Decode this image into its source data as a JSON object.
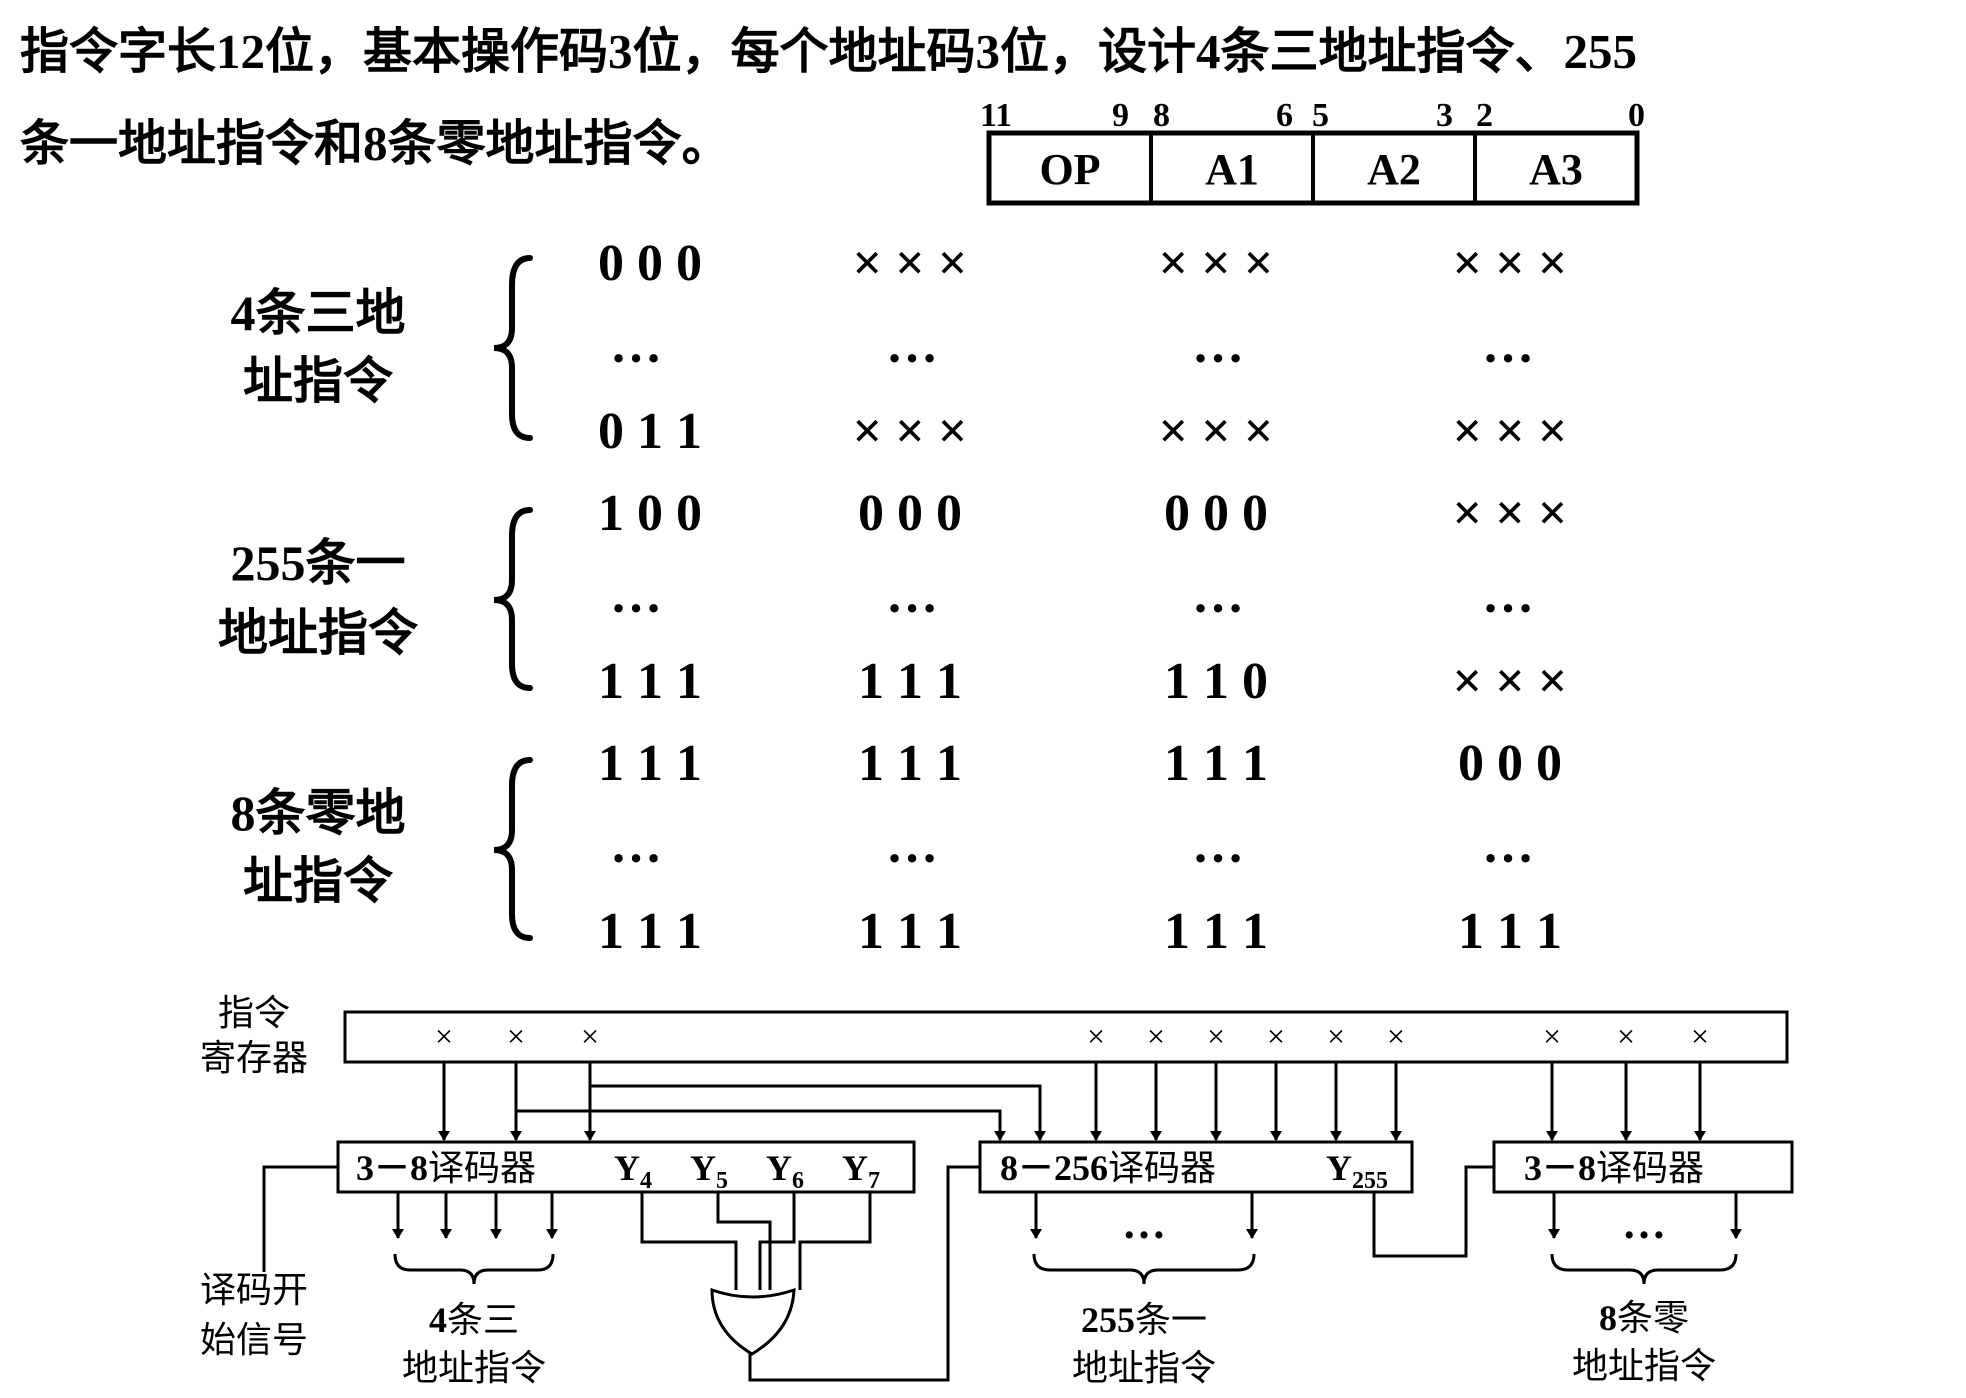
{
  "heading": {
    "line1": "指令字长12位，基本操作码3位，每个地址码3位，设计4条三地址指令、255",
    "line2": "条一地址指令和8条零地址指令。"
  },
  "format": {
    "bit_labels": [
      "11",
      "9",
      "8",
      "6",
      "5",
      "3",
      "2",
      "0"
    ],
    "fields": [
      "OP",
      "A1",
      "A2",
      "A3"
    ]
  },
  "groups": [
    {
      "label_line1": "4条三地",
      "label_line2": "址指令",
      "first": [
        "0 0 0",
        "× × ×",
        "× × ×",
        "× × ×"
      ],
      "last": [
        "0 1 1",
        "× × ×",
        "× × ×",
        "× × ×"
      ]
    },
    {
      "label_line1": "255条一",
      "label_line2": "地址指令",
      "first": [
        "1 0 0",
        "0 0 0",
        "0 0 0",
        "× × ×"
      ],
      "last": [
        "1 1 1",
        "1 1 1",
        "1 1 0",
        "× × ×"
      ]
    },
    {
      "label_line1": "8条零地",
      "label_line2": "址指令",
      "first": [
        "1 1 1",
        "1 1 1",
        "1 1 1",
        "0 0 0"
      ],
      "last": [
        "1 1 1",
        "1 1 1",
        "1 1 1",
        "1 1 1"
      ]
    }
  ],
  "ellipsis": "…",
  "circuit": {
    "register_label_line1": "指令",
    "register_label_line2": "寄存器",
    "register_marks": [
      "×",
      "×",
      "×",
      "×",
      "×",
      "×",
      "×",
      "×",
      "×",
      "×",
      "×",
      "×"
    ],
    "start_signal_line1": "译码开",
    "start_signal_line2": "始信号",
    "decoder1": {
      "prefix": "3－8",
      "suffix": "译码器",
      "outputs": [
        {
          "base": "Y",
          "sub": "4"
        },
        {
          "base": "Y",
          "sub": "5"
        },
        {
          "base": "Y",
          "sub": "6"
        },
        {
          "base": "Y",
          "sub": "7"
        }
      ]
    },
    "decoder2": {
      "prefix": "8－256",
      "suffix": "译码器",
      "outputs": [
        {
          "base": "Y",
          "sub": "255"
        }
      ]
    },
    "decoder3": {
      "prefix": "3－8",
      "suffix": "译码器"
    },
    "output_ellipsis": "…",
    "out_labels": [
      {
        "num": "4",
        "line1_rest": "条三",
        "line2": "地址指令"
      },
      {
        "num": "255",
        "line1_rest": "条一",
        "line2": "地址指令"
      },
      {
        "num": "8",
        "line1_rest": "条零",
        "line2": "地址指令"
      }
    ]
  }
}
